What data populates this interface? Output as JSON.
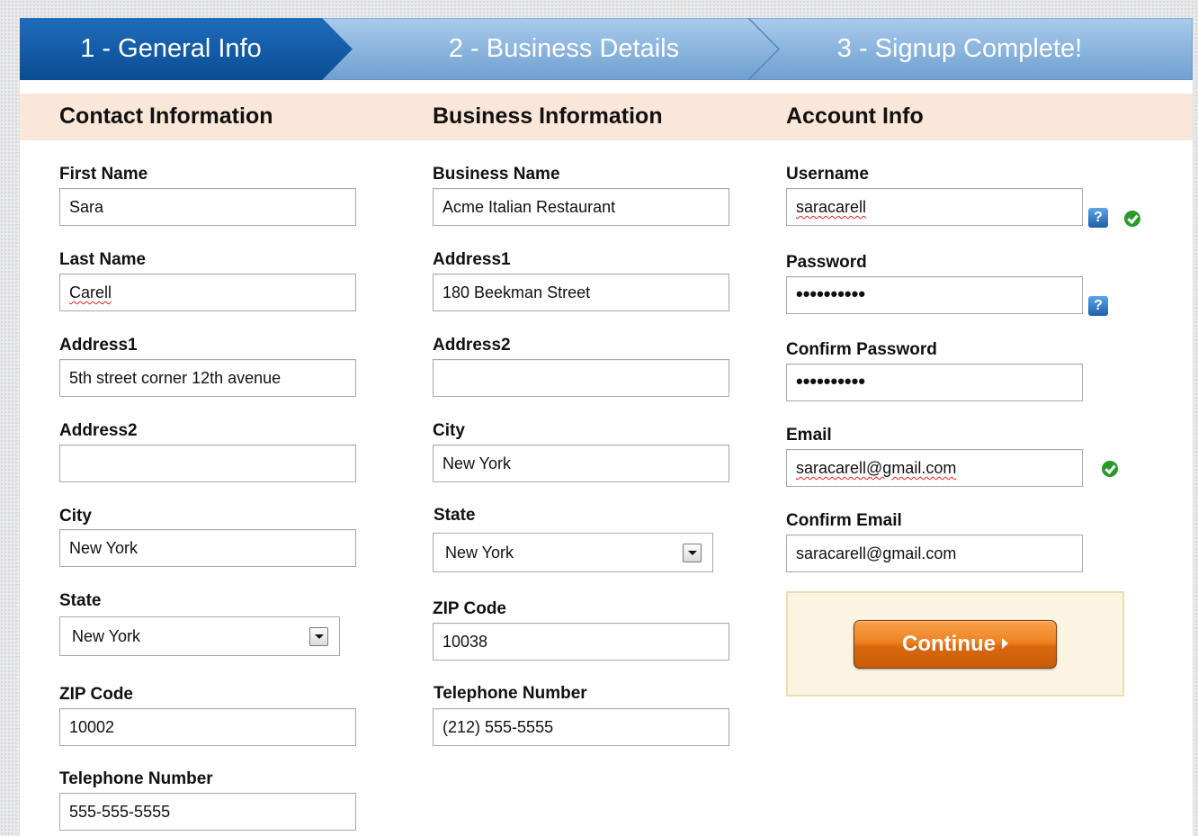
{
  "steps": [
    {
      "label": "1 - General Info",
      "active": true
    },
    {
      "label": "2 - Business Details",
      "active": false
    },
    {
      "label": "3 - Signup Complete!",
      "active": false
    }
  ],
  "contact": {
    "title": "Contact Information",
    "first_name": {
      "label": "First Name",
      "value": "Sara"
    },
    "last_name": {
      "label": "Last Name",
      "value": "Carell"
    },
    "address1": {
      "label": "Address1",
      "value": "5th street corner 12th avenue"
    },
    "address2": {
      "label": "Address2",
      "value": ""
    },
    "city": {
      "label": "City",
      "value": "New York"
    },
    "state": {
      "label": "State",
      "value": "New York"
    },
    "zip": {
      "label": "ZIP Code",
      "value": "10002"
    },
    "phone": {
      "label": "Telephone Number",
      "value": "555-555-5555"
    }
  },
  "business": {
    "title": "Business Information",
    "name": {
      "label": "Business Name",
      "value": "Acme Italian Restaurant"
    },
    "address1": {
      "label": "Address1",
      "value": "180 Beekman Street"
    },
    "address2": {
      "label": "Address2",
      "value": ""
    },
    "city": {
      "label": "City",
      "value": "New York"
    },
    "state": {
      "label": "State",
      "value": "New York"
    },
    "zip": {
      "label": "ZIP Code",
      "value": "10038"
    },
    "phone": {
      "label": "Telephone Number",
      "value": "(212) 555-5555"
    }
  },
  "account": {
    "title": "Account Info",
    "username": {
      "label": "Username",
      "value": "saracarell"
    },
    "password": {
      "label": "Password",
      "value": "••••••••••"
    },
    "confirm_password": {
      "label": "Confirm Password",
      "value": "••••••••••"
    },
    "email": {
      "label": "Email",
      "value": "saracarell@gmail.com"
    },
    "confirm_email": {
      "label": "Confirm Email",
      "value": "saracarell@gmail.com"
    },
    "help_glyph": "?"
  },
  "continue_label": "Continue",
  "colors": {
    "active_step": "#0d5aa7",
    "inactive_step": "#8bb6e0",
    "band": "#fbe7d9",
    "continue": "#ee8320",
    "valid": "#2a9a2a"
  }
}
